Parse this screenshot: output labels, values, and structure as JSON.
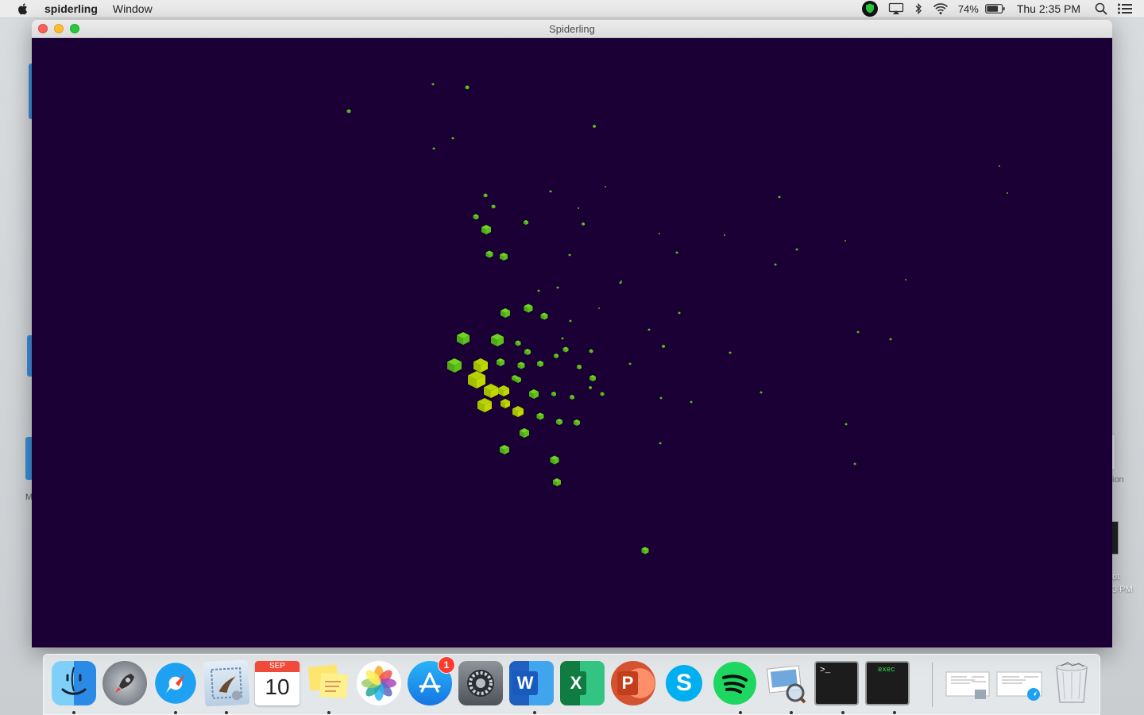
{
  "menubar": {
    "app_name": "spiderling",
    "menus": [
      "Window"
    ],
    "battery_percent": "74%",
    "clock": "Thu 2:35 PM",
    "icons": [
      "shield-icon",
      "airplay-icon",
      "bluetooth-icon",
      "wifi-icon",
      "battery-icon",
      "spotlight-search-icon",
      "notification-center-icon"
    ]
  },
  "window": {
    "title": "Spiderling",
    "background_color": "#1a0034",
    "cube_color": "#6fd51e",
    "cube_highlight_color": "#b8d400"
  },
  "desktop": {
    "partial_labels": [
      "ion",
      "ot",
      "3 PM",
      "M"
    ]
  },
  "dock": {
    "apps": [
      {
        "name": "Finder",
        "icon": "finder-icon",
        "running": true
      },
      {
        "name": "Launchpad",
        "icon": "launchpad-icon",
        "running": false
      },
      {
        "name": "Safari",
        "icon": "safari-icon",
        "running": true
      },
      {
        "name": "Mail",
        "icon": "mail-icon",
        "running": true
      },
      {
        "name": "Calendar",
        "icon": "calendar-icon",
        "running": false,
        "month": "SEP",
        "day": "10"
      },
      {
        "name": "Stickies",
        "icon": "stickies-icon",
        "running": true
      },
      {
        "name": "Photos",
        "icon": "photos-icon",
        "running": false
      },
      {
        "name": "App Store",
        "icon": "app-store-icon",
        "running": false,
        "badge": "1"
      },
      {
        "name": "System Preferences",
        "icon": "system-preferences-icon",
        "running": false
      },
      {
        "name": "Microsoft Word",
        "icon": "word-icon",
        "running": true,
        "letter": "W"
      },
      {
        "name": "Microsoft Excel",
        "icon": "excel-icon",
        "running": false,
        "letter": "X"
      },
      {
        "name": "Microsoft PowerPoint",
        "icon": "powerpoint-icon",
        "running": false,
        "letter": "P"
      },
      {
        "name": "Skype",
        "icon": "skype-icon",
        "running": false,
        "letter": "S"
      },
      {
        "name": "Spotify",
        "icon": "spotify-icon",
        "running": true
      },
      {
        "name": "Preview",
        "icon": "preview-icon",
        "running": true
      },
      {
        "name": "Terminal",
        "icon": "terminal-icon",
        "running": true,
        "prompt": ">_"
      },
      {
        "name": "exec",
        "icon": "exec-terminal-icon",
        "running": true,
        "label": "exec"
      }
    ],
    "stacks": [
      {
        "name": "Documents stack",
        "icon": "documents-stack-icon"
      },
      {
        "name": "Downloads stack",
        "icon": "downloads-stack-icon"
      }
    ],
    "trash": {
      "name": "Trash",
      "icon": "trash-icon"
    }
  }
}
